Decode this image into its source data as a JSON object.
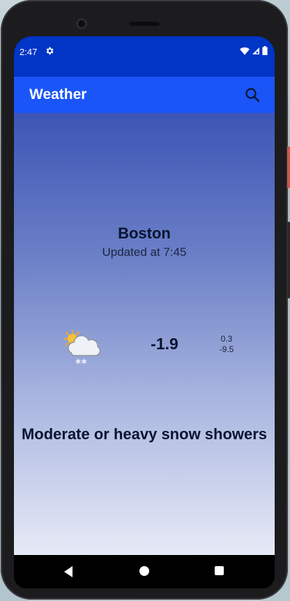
{
  "status_bar": {
    "time": "2:47",
    "icons": [
      "gear-icon",
      "wifi-icon",
      "cell-signal-icon",
      "battery-icon"
    ]
  },
  "app_bar": {
    "title": "Weather",
    "action_icon": "search-icon"
  },
  "weather": {
    "city": "Boston",
    "updated": "Updated at 7:45",
    "condition_icon": "partly-cloudy-snow-icon",
    "temperature": "-1.9",
    "temp_max": "0.3",
    "temp_min": "-9.5",
    "description": "Moderate or heavy snow showers"
  },
  "navigation": {
    "buttons": [
      "back-icon",
      "home-icon",
      "recent-apps-icon"
    ]
  },
  "colors": {
    "status_bar": "#0035c6",
    "app_bar": "#1a55f7",
    "gradient_top": "#3d55b5",
    "gradient_bottom": "#e7eaf6"
  }
}
